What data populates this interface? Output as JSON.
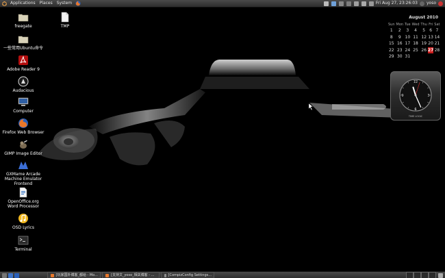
{
  "top_panel": {
    "menus": [
      "Applications",
      "Places",
      "System"
    ],
    "clock": "Fri Aug 27, 23:26:03",
    "user": "yoso"
  },
  "desktop_icons": [
    {
      "label": "freegate",
      "icon": "folder-icon"
    },
    {
      "label": "TMP",
      "icon": "file-icon"
    },
    {
      "label": "一些常用Ubuntu命令",
      "icon": "folder-icon"
    },
    {
      "label": "Adobe Reader 9",
      "icon": "adobe-reader-icon"
    },
    {
      "label": "Audacious",
      "icon": "audacious-icon"
    },
    {
      "label": "Computer",
      "icon": "computer-icon"
    },
    {
      "label": "Firefox Web Browser",
      "icon": "firefox-icon"
    },
    {
      "label": "GIMP Image Editor",
      "icon": "gimp-icon"
    },
    {
      "label": "GXMame Arcade\nMachine Emulator\nFrontend",
      "icon": "gxmame-icon"
    },
    {
      "label": "OpenOffice.org\nWord Processor",
      "icon": "openoffice-writer-icon"
    },
    {
      "label": "OSD Lyrics",
      "icon": "osd-lyrics-icon"
    },
    {
      "label": "Terminal",
      "icon": "terminal-icon"
    }
  ],
  "calendar": {
    "title": "August 2010",
    "weekdays": [
      "Sun",
      "Mon",
      "Tue",
      "Wed",
      "Thu",
      "Fri",
      "Sat"
    ],
    "weeks": [
      [
        "1",
        "2",
        "3",
        "4",
        "5",
        "6",
        "7"
      ],
      [
        "8",
        "9",
        "10",
        "11",
        "12",
        "13",
        "14"
      ],
      [
        "15",
        "16",
        "17",
        "18",
        "19",
        "20",
        "21"
      ],
      [
        "22",
        "23",
        "24",
        "25",
        "26",
        "27",
        "28"
      ],
      [
        "29",
        "30",
        "31",
        "",
        "",
        "",
        ""
      ]
    ],
    "today": "27",
    "today_color": "#cc1f1f"
  },
  "clock_widget": {
    "hour": 11,
    "minute": 26,
    "second": 3,
    "numerals": [
      "12",
      "3",
      "6",
      "9"
    ],
    "brand": "TIME LOGIC"
  },
  "taskbar": {
    "tasks": [
      {
        "label": "[玩家国外博客_都给 - Mo..."
      },
      {
        "label": "[支持文_yoso_相关博客 - ..."
      },
      {
        "label": "[CompizConfig Settings..."
      }
    ]
  },
  "colors": {
    "panel": "#3a3a3a",
    "desktop": "#000000",
    "accent": "#cc1f1f"
  }
}
